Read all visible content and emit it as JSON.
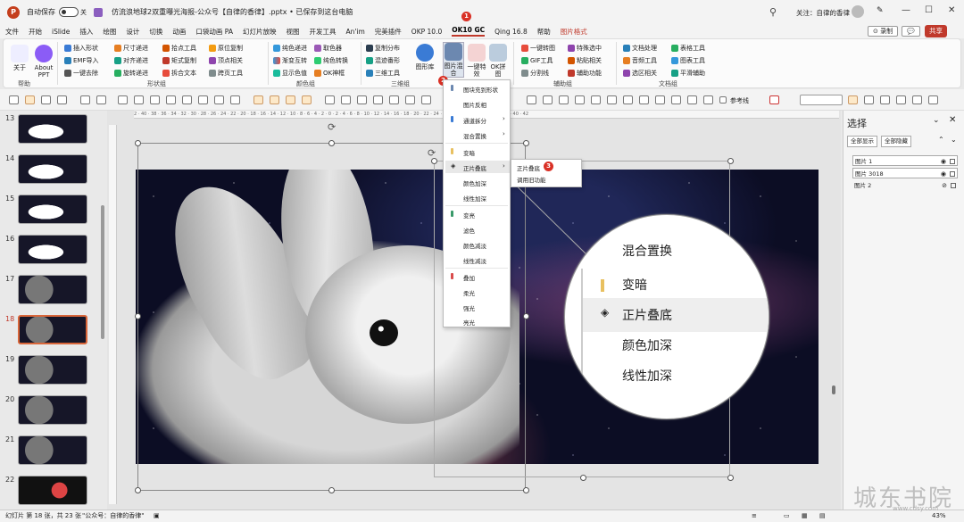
{
  "titlebar": {
    "autosave_label": "自动保存",
    "toggle_state": "关",
    "doc_title": "仿流浪地球2双重曝光海报-公众号【自律的香律】.pptx • 已保存到这台电脑",
    "user": "关注：自律的香律",
    "window_buttons": [
      "—",
      "☐",
      "✕"
    ]
  },
  "menubar": {
    "items": [
      "文件",
      "开始",
      "iSlide",
      "插入",
      "绘图",
      "设计",
      "切换",
      "动画",
      "口袋动画 PA",
      "幻灯片放映",
      "视图",
      "开发工具",
      "An'im",
      "完美插件",
      "OKP 10.0",
      "OK10 GC",
      "Qing 16.8",
      "帮助",
      "图片格式"
    ],
    "active": "OK10 GC",
    "record": "⊙ 录制",
    "comment": "💬",
    "share": "共享"
  },
  "ribbon": {
    "about": [
      "关于",
      "About PPT"
    ],
    "group_labels": [
      "帮助",
      "形状组",
      "颜色组",
      "三维组",
      "辅助组",
      "文档组"
    ],
    "shape_items": [
      "插入形状",
      "尺寸递进",
      "拾点工具",
      "原位复制",
      "EMF导入",
      "对齐递进",
      "矩式复制",
      "顶点相关",
      "一键去除",
      "旋转递进",
      "拆合文本",
      "跨页工具"
    ],
    "color_items": [
      "纯色递进",
      "取色器",
      "渐变互转",
      "纯色转换",
      "显示色值",
      "OK神框"
    ],
    "three_d_items": [
      "复制分布",
      "混迹番形",
      "三维工具"
    ],
    "three_d_big": "图形库",
    "img_big": [
      "图片混合",
      "一键特效",
      "OK拼图"
    ],
    "aux_items": [
      "一键转图",
      "特殊选中",
      "GIF工具",
      "粘贴相关",
      "分割线",
      "辅助功能"
    ],
    "doc_items": [
      "文档处理",
      "表格工具",
      "音频工具",
      "图表工具",
      "选区相关",
      "平滑辅助"
    ]
  },
  "toolbar2": {
    "ref_line": "参考线"
  },
  "slides": {
    "numbers": [
      "13",
      "14",
      "15",
      "16",
      "17",
      "18",
      "19",
      "20",
      "21",
      "22"
    ],
    "active": "18"
  },
  "ruler_text": "2 · 40 · 38 · 36 · 34 · 32 · 30 · 28 · 26 · 24 · 22 · 20 · 18 · 16 · 14 · 12 · 10 · 8 · 6 · 4 · 2 · 0 · 2 · 4 · 6 · 8 · 10 · 12 · 14 · 16 · 18 · 20 · 22 · 24 · 26 · 28 · 30 · 32 · 34 · 36 · 38 · 40 · 42",
  "dropdown": {
    "items": [
      "图块充到形状",
      "图片反相",
      "通道拆分",
      "混合置换",
      "变暗",
      "正片叠底",
      "颜色加深",
      "线性加深",
      "变亮",
      "滤色",
      "颜色减淡",
      "线性减淡",
      "叠加",
      "柔光",
      "强光",
      "亮光"
    ],
    "submenu": [
      "正片叠底",
      "调用旧功能"
    ]
  },
  "magnifier": {
    "items": [
      "混合置换",
      "变暗",
      "正片叠底",
      "颜色加深",
      "线性加深"
    ]
  },
  "badges": [
    "1",
    "2",
    "3"
  ],
  "selection_pane": {
    "title": "选择",
    "show_all": "全部显示",
    "hide_all": "全部隐藏",
    "rows": [
      "图片 1",
      "图片 3018",
      "图片 2"
    ]
  },
  "statusbar": {
    "slide_info": "幻灯片 第 18 张，共 23 张",
    "theme": "\"公众号：自律的香律\"",
    "zoom": "43%"
  },
  "watermark": {
    "text": "城东书院",
    "url": "www.cdsy.com"
  }
}
